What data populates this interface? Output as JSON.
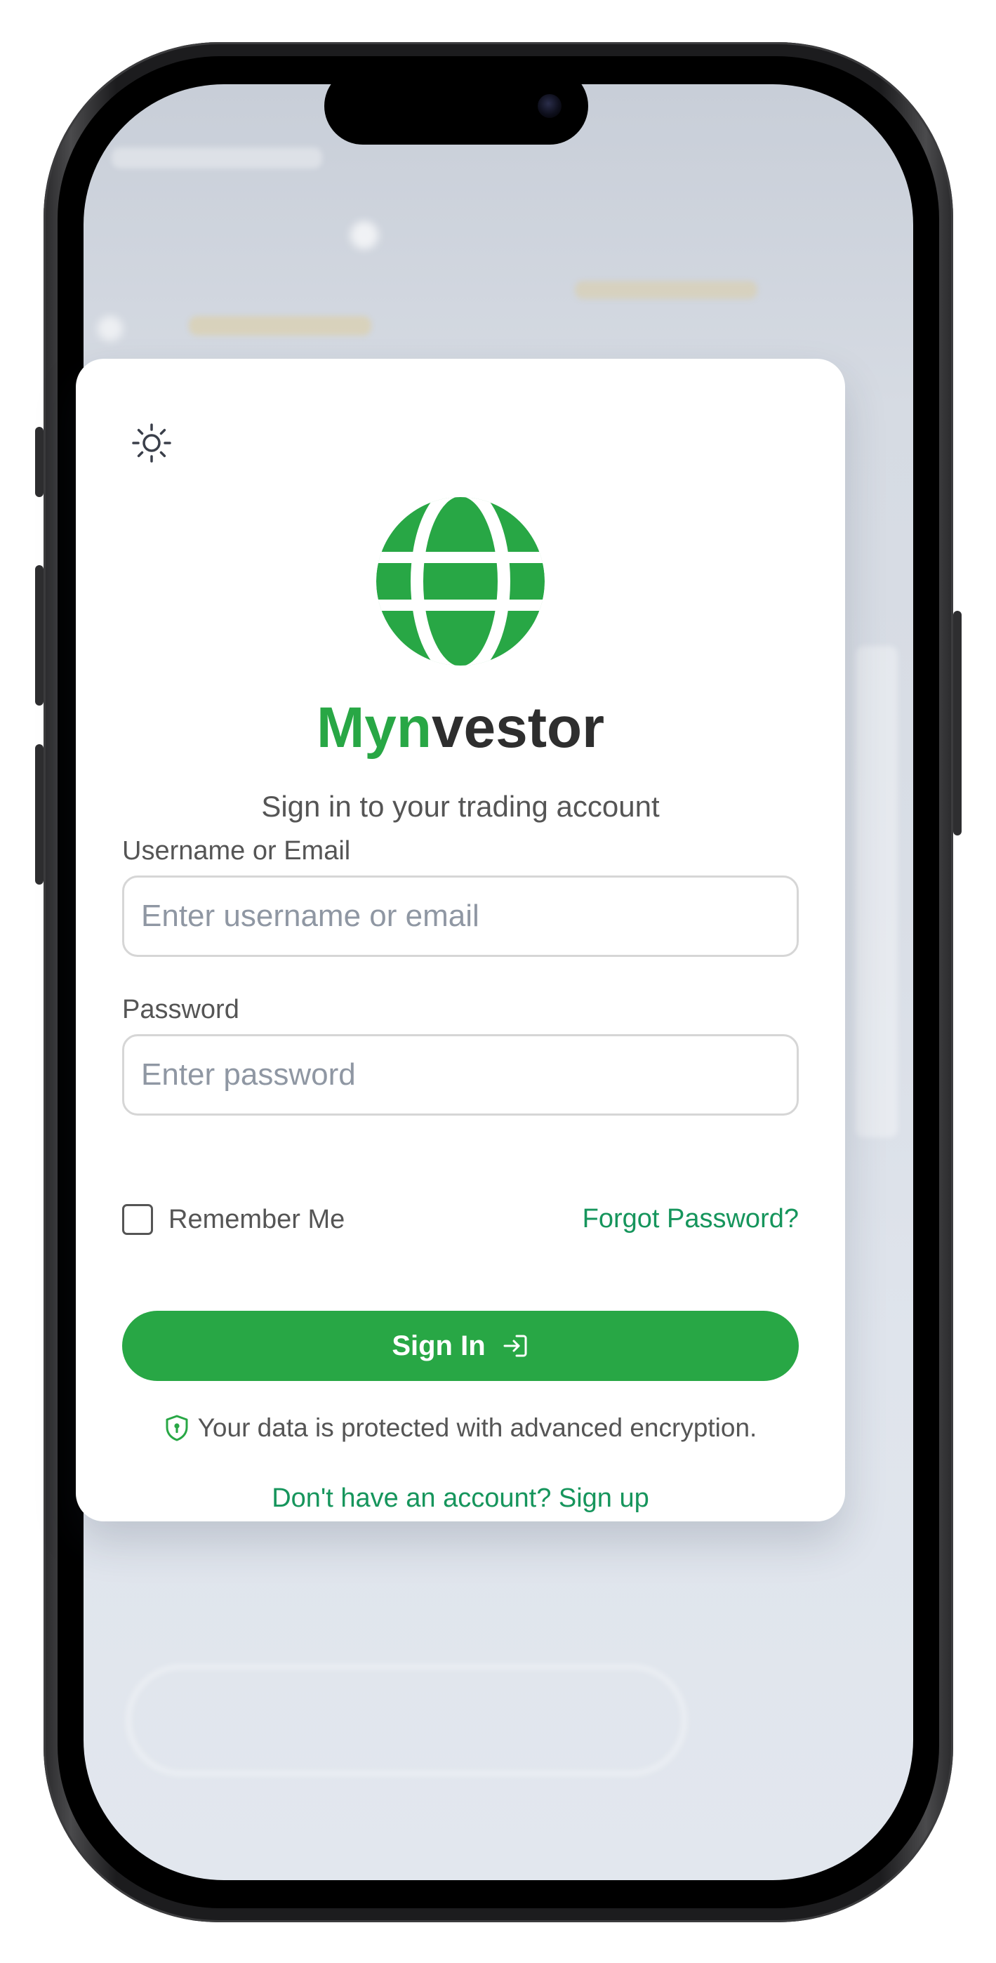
{
  "app": {
    "brand_prefix": "Myn",
    "brand_suffix": "vestor",
    "subtitle": "Sign in to your trading account",
    "logo_icon": "globe-icon",
    "theme_toggle_icon": "sun-icon"
  },
  "form": {
    "username_label": "Username or Email",
    "username_placeholder": "Enter username or email",
    "password_label": "Password",
    "password_placeholder": "Enter password",
    "remember_label": "Remember Me",
    "forgot_label": "Forgot Password?",
    "signin_label": "Sign In",
    "signin_icon": "log-in-icon"
  },
  "footer": {
    "security_icon": "shield-icon",
    "security_text": "Your data is protected with advanced encryption.",
    "signup_text": "Don't have an account? Sign up"
  },
  "colors": {
    "accent": "#28a745",
    "link": "#16955c",
    "text": "#555555",
    "brand_dark": "#2e2e2e"
  }
}
